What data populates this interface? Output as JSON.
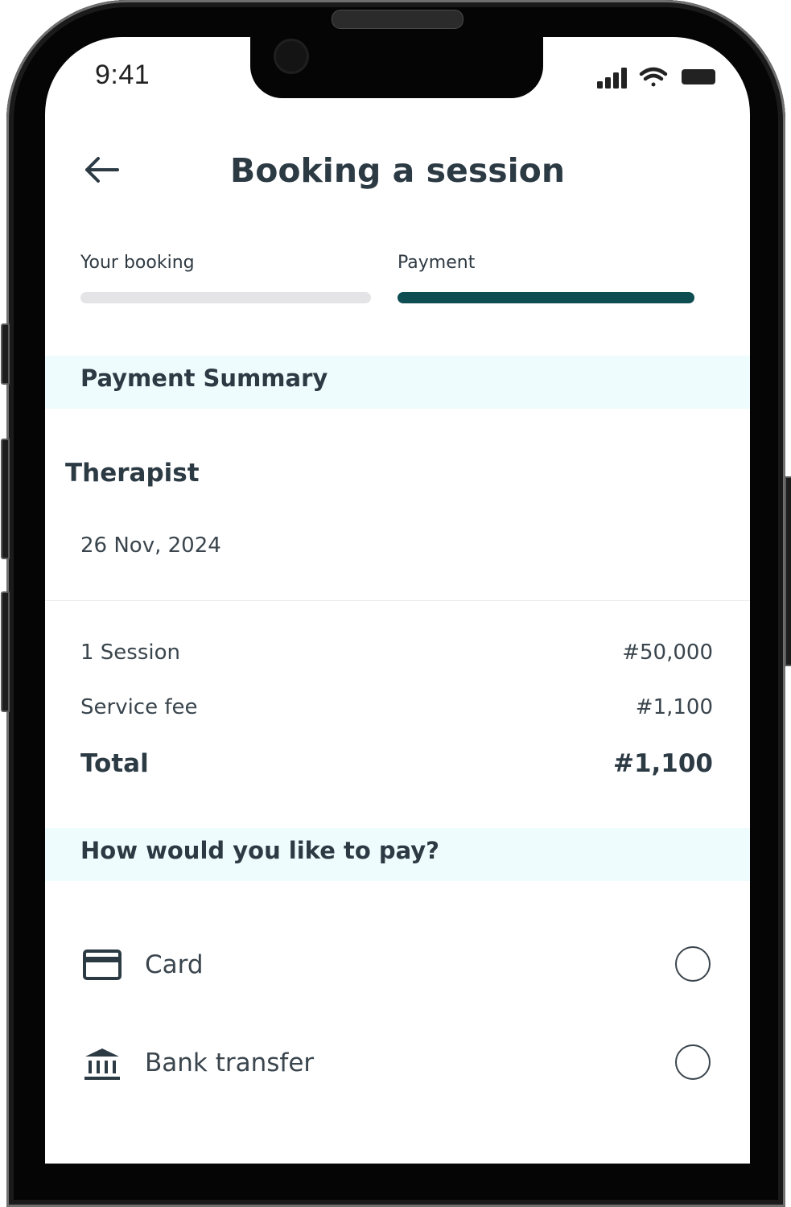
{
  "status_bar": {
    "time": "9:41",
    "icons": [
      "cellular-signal-icon",
      "wifi-icon",
      "battery-icon"
    ]
  },
  "header": {
    "back_icon": "arrow-left-icon",
    "title": "Booking a session"
  },
  "steps": [
    {
      "label": "Your booking",
      "active": false
    },
    {
      "label": "Payment",
      "active": true
    }
  ],
  "colors": {
    "accent": "#0e4e53",
    "banner_bg": "#effcfd",
    "inactive_bar": "#e4e4e7",
    "text_dark": "#2c3a44"
  },
  "summary": {
    "heading": "Payment Summary",
    "therapist_label": "Therapist",
    "date": "26 Nov, 2024",
    "rows": [
      {
        "label": "1 Session",
        "value": "#50,000"
      },
      {
        "label": "Service fee",
        "value": "#1,100"
      }
    ],
    "total": {
      "label": "Total",
      "value": "#1,100"
    }
  },
  "payment": {
    "heading": "How would you like to pay?",
    "options": [
      {
        "label": "Card",
        "icon": "credit-card-icon",
        "selected": false
      },
      {
        "label": "Bank transfer",
        "icon": "bank-icon",
        "selected": false
      }
    ]
  }
}
